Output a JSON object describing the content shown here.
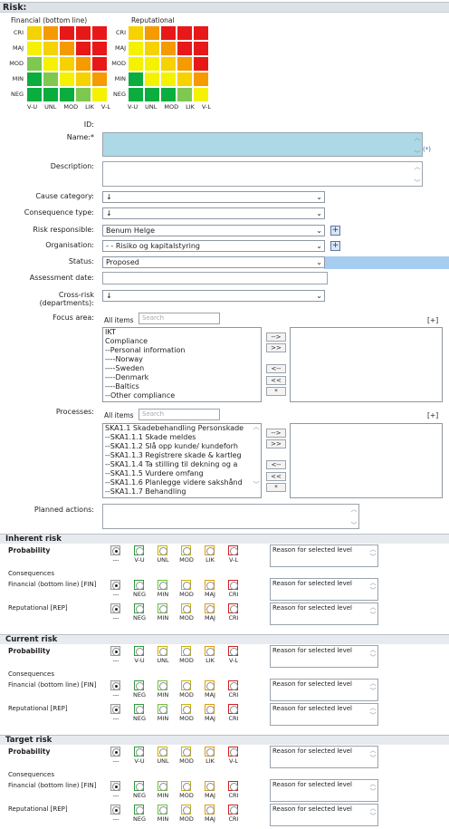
{
  "header": {
    "title": "Risk:"
  },
  "matrices": {
    "financial_title": "Financial (bottom line)",
    "reputational_title": "Reputational",
    "row_labels": [
      "CRI",
      "MAJ",
      "MOD",
      "MIN",
      "NEG"
    ],
    "col_labels": [
      "V-U",
      "UNL",
      "MOD",
      "LIK",
      "V-L"
    ],
    "financial_colors": [
      [
        "#f5d200",
        "#f59a00",
        "#e81818",
        "#e81818",
        "#e81818"
      ],
      [
        "#f4f200",
        "#f5d200",
        "#f59a00",
        "#e81818",
        "#e81818"
      ],
      [
        "#7ec850",
        "#f4f200",
        "#f5d200",
        "#f59a00",
        "#e81818"
      ],
      [
        "#0aad3e",
        "#7ec850",
        "#f4f200",
        "#f5d200",
        "#f59a00"
      ],
      [
        "#0aad3e",
        "#0aad3e",
        "#0aad3e",
        "#7ec850",
        "#f4f200"
      ]
    ],
    "reputational_colors": [
      [
        "#f5d200",
        "#f59a00",
        "#e81818",
        "#e81818",
        "#e81818"
      ],
      [
        "#f4f200",
        "#f5d200",
        "#f59a00",
        "#e81818",
        "#e81818"
      ],
      [
        "#f4f200",
        "#f4f200",
        "#f5d200",
        "#f59a00",
        "#e81818"
      ],
      [
        "#0aad3e",
        "#f4f200",
        "#f4f200",
        "#f5d200",
        "#f59a00"
      ],
      [
        "#0aad3e",
        "#0aad3e",
        "#0aad3e",
        "#7ec850",
        "#f4f200"
      ]
    ]
  },
  "form": {
    "id_label": "ID:",
    "name_label": "Name:*",
    "name_suffix": "(*)",
    "description_label": "Description:",
    "cause_label": "Cause category:",
    "cause_value": "↓",
    "consequence_label": "Consequence type:",
    "consequence_value": "↓",
    "responsible_label": "Risk responsible:",
    "responsible_value": "Benum Helge",
    "organisation_label": "Organisation:",
    "organisation_value": "- - Risiko og kapitalstyring",
    "status_label": "Status:",
    "status_value": "Proposed",
    "assessment_label": "Assessment date:",
    "crossrisk_label_1": "Cross-risk",
    "crossrisk_label_2": "(departments):",
    "crossrisk_value": "↓",
    "focus_label": "Focus area:",
    "processes_label": "Processes:",
    "planned_label": "Planned actions:",
    "plus_sign": "+"
  },
  "focus": {
    "all_items": "All items",
    "search_placeholder": "Search",
    "expand": "[+]",
    "items": [
      "IKT",
      "Compliance",
      "--Personal information",
      "----Norway",
      "----Sweden",
      "----Denmark",
      "----Baltics",
      "--Other compliance"
    ]
  },
  "processes": {
    "all_items": "All items",
    "search_placeholder": "Search",
    "expand": "[+]",
    "items": [
      "SKA1.1 Skadebehandling Personskade",
      "--SKA1.1.1 Skade meldes",
      "--SKA1.1.2 Slå opp kunde/ kundeforh",
      "--SKA1.1.3 Registrere skade & kartleg",
      "--SKA1.1.4 Ta stilling til dekning og a",
      "--SKA1.1.5 Vurdere omfang",
      "--SKA1.1.6 Planlegge videre sakshånd",
      "--SKA1.1.7 Behandling"
    ]
  },
  "transfer_buttons": [
    "-->",
    ">>",
    "<--",
    "<<",
    "*"
  ],
  "assessment": {
    "prob_labels": [
      "---",
      "V-U",
      "UNL",
      "MOD",
      "LIK",
      "V-L"
    ],
    "cons_labels": [
      "---",
      "NEG",
      "MIN",
      "MOD",
      "MAJ",
      "CRI"
    ],
    "probability": "Probability",
    "consequences": "Consequences",
    "fin": "Financial (bottom line) [FIN]",
    "rep": "Reputational [REP]",
    "reason": "Reason for selected level",
    "sections": [
      {
        "title": "Inherent risk"
      },
      {
        "title": "Current risk"
      },
      {
        "title": "Target risk"
      }
    ]
  },
  "colors": {
    "green": "#2e9a3a",
    "lime": "#6fbf3a",
    "yellow": "#c8b400",
    "orange": "#e69a00",
    "red": "#d41e1e",
    "name_bg": "#add8e6",
    "status_bar": "#a6cdf0"
  }
}
